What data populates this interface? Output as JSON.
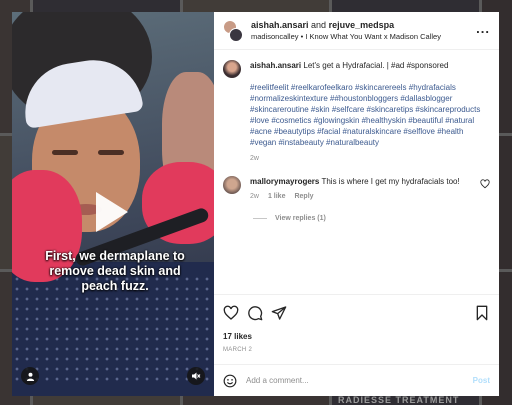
{
  "post": {
    "header": {
      "author": "aishah.ansari",
      "connector": "and",
      "collaborator": "rejuve_medspa",
      "audio_line": "madisoncalley • I Know What You Want x Madison Calley",
      "more_label": "..."
    },
    "video": {
      "overlay_caption": "First, we dermaplane to remove dead skin and peach fuzz."
    },
    "caption": {
      "author": "aishah.ansari",
      "text": "Let's get a Hydrafacial. | #ad #sponsored",
      "hashtags": "#reelitfeelit #reelkarofeelkaro #skincarereels #hydrafacials #normalizeskintexture ##houstonbloggers #dallasblogger #skincareroutine #skin #selfcare #skincaretips #skincareproducts #love #cosmetics #glowingskin #healthyskin #beautiful #natural #acne #beautytips #facial #naturalskincare #selflove #health #vegan #instabeauty #naturalbeauty",
      "age": "2w"
    },
    "comment": {
      "author": "mallorymayrogers",
      "text": "This is where I get my hydrafacials too!",
      "age": "2w",
      "likes": "1 like",
      "reply_label": "Reply"
    },
    "view_replies": "View replies (1)",
    "likes": "17 likes",
    "date": "MARCH 2",
    "add_comment": {
      "placeholder": "Add a comment...",
      "post_label": "Post"
    }
  },
  "background": {
    "partial_label": "RADIESSE TREATMENT"
  },
  "colors": {
    "hashtag": "#3c5a8f",
    "post_button": "#b2dffc",
    "glove": "#e13a5c"
  }
}
